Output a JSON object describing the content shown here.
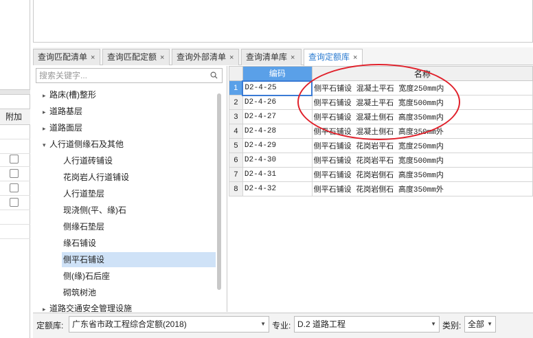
{
  "left_panel": {
    "column_header": "附加",
    "checkbox_rows": 4
  },
  "tabs": [
    {
      "label": "查询匹配清单",
      "active": false
    },
    {
      "label": "查询匹配定额",
      "active": false
    },
    {
      "label": "查询外部清单",
      "active": false
    },
    {
      "label": "查询清单库",
      "active": false
    },
    {
      "label": "查询定额库",
      "active": true
    }
  ],
  "tab_close_glyph": "×",
  "search": {
    "placeholder": "搜索关键字..."
  },
  "tree": [
    {
      "label": "路床(槽)整形",
      "level": 0,
      "expanded": false
    },
    {
      "label": "道路基层",
      "level": 0,
      "expanded": false
    },
    {
      "label": "道路面层",
      "level": 0,
      "expanded": false
    },
    {
      "label": "人行道侧缘石及其他",
      "level": 0,
      "expanded": true
    },
    {
      "label": "人行道砖铺设",
      "level": 1
    },
    {
      "label": "花岗岩人行道铺设",
      "level": 1
    },
    {
      "label": "人行道垫层",
      "level": 1
    },
    {
      "label": "现浇侧(平、缘)石",
      "level": 1
    },
    {
      "label": "侧缘石垫层",
      "level": 1
    },
    {
      "label": "缘石铺设",
      "level": 1
    },
    {
      "label": "侧平石铺设",
      "level": 1,
      "selected": true
    },
    {
      "label": "侧(缘)石后座",
      "level": 1
    },
    {
      "label": "砌筑树池",
      "level": 1
    },
    {
      "label": "道路交通安全管理设施",
      "level": 0,
      "expanded": false
    }
  ],
  "grid": {
    "headers": {
      "code": "编码",
      "name": "名称"
    },
    "rows": [
      {
        "no": "1",
        "code": "D2-4-25",
        "name": "侧平石铺设 混凝土平石 宽度250mm内"
      },
      {
        "no": "2",
        "code": "D2-4-26",
        "name": "侧平石铺设 混凝土平石 宽度500mm内"
      },
      {
        "no": "3",
        "code": "D2-4-27",
        "name": "侧平石铺设 混凝土侧石 高度350mm内"
      },
      {
        "no": "4",
        "code": "D2-4-28",
        "name": "侧平石铺设 混凝土侧石 高度350mm外"
      },
      {
        "no": "5",
        "code": "D2-4-29",
        "name": "侧平石铺设 花岗岩平石 宽度250mm内"
      },
      {
        "no": "6",
        "code": "D2-4-30",
        "name": "侧平石铺设 花岗岩平石 宽度500mm内"
      },
      {
        "no": "7",
        "code": "D2-4-31",
        "name": "侧平石铺设 花岗岩侧石 高度350mm内"
      },
      {
        "no": "8",
        "code": "D2-4-32",
        "name": "侧平石铺设 花岗岩侧石 高度350mm外"
      }
    ]
  },
  "footer": {
    "quota_label": "定额库:",
    "quota_value": "广东省市政工程综合定额(2018)",
    "major_label": "专业:",
    "major_value": "D.2 道路工程",
    "category_label": "类别:",
    "category_value": "全部"
  },
  "colors": {
    "accent": "#5aa0e8",
    "annotation": "#e0202a",
    "selection": "#cfe2f7"
  }
}
